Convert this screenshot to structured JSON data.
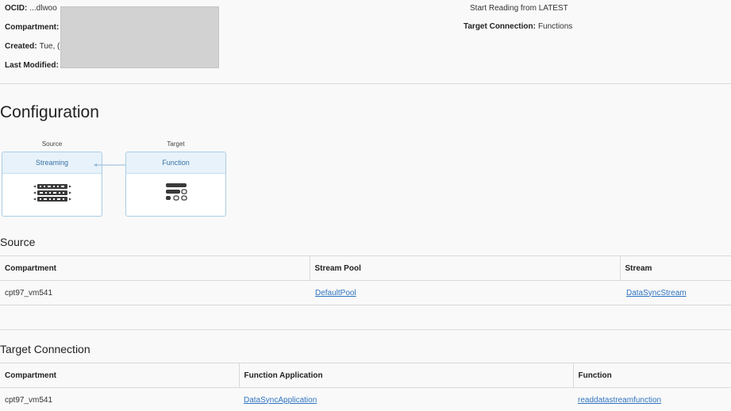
{
  "details": {
    "ocid_label": "OCID:",
    "ocid_value": "...dlwoo",
    "compartment_label": "Compartment:",
    "created_label": "Created:",
    "created_value": "Tue, (",
    "last_modified_label": "Last Modified:",
    "start_reading": "Start Reading from LATEST",
    "target_connection_label": "Target Connection:",
    "target_connection_value": "Functions"
  },
  "configuration": {
    "title": "Configuration",
    "source_label": "Source",
    "source_card": "Streaming",
    "target_label": "Target",
    "target_card": "Function"
  },
  "source": {
    "title": "Source",
    "columns": [
      "Compartment",
      "Stream Pool",
      "Stream"
    ],
    "row": [
      "cpt97_vm541",
      "DefaultPool",
      "DataSyncStream"
    ]
  },
  "target": {
    "title": "Target Connection",
    "columns": [
      "Compartment",
      "Function Application",
      "Function"
    ],
    "row": [
      "cpt97_vm541",
      "DataSyncApplication",
      "readdatastreamfunction"
    ]
  },
  "colors": {
    "accent": "#2f73c1",
    "card_border": "#a9cde6",
    "card_header": "#e8f2fa"
  },
  "icons": {
    "source": "stream-data-icon",
    "target": "function-icon"
  }
}
